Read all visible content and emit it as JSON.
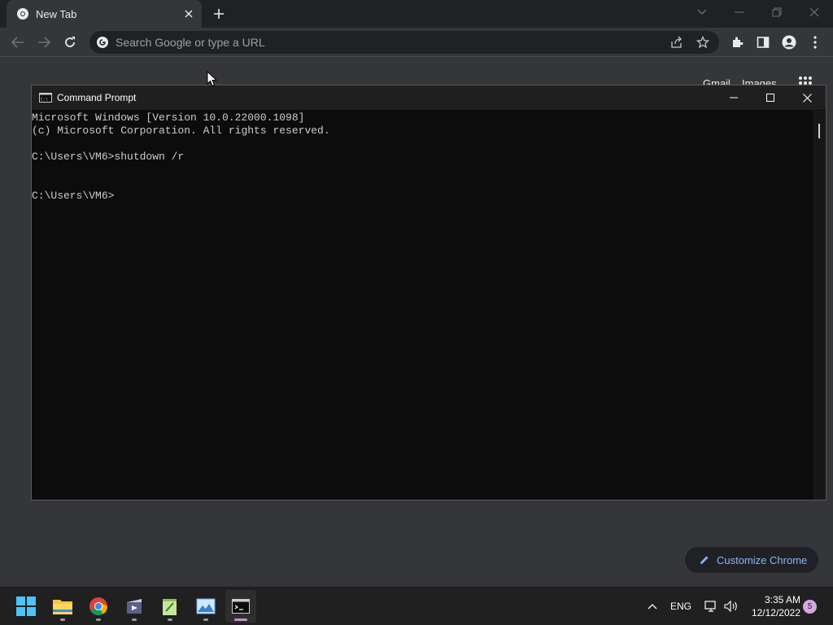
{
  "browser": {
    "tab_title": "New Tab",
    "omnibox_placeholder": "Search Google or type a URL",
    "ntp": {
      "gmail_label": "Gmail",
      "images_label": "Images",
      "customize_label": "Customize Chrome"
    }
  },
  "cmd": {
    "title": "Command Prompt",
    "lines": [
      "Microsoft Windows [Version 10.0.22000.1098]",
      "(c) Microsoft Corporation. All rights reserved.",
      "",
      "C:\\Users\\VM6>shutdown /r",
      "",
      "",
      "C:\\Users\\VM6>"
    ]
  },
  "taskbar": {
    "apps": [
      "start-icon",
      "file-explorer-icon",
      "chrome-icon",
      "video-editor-icon",
      "notepad-plus-icon",
      "photo-viewer-icon",
      "command-prompt-icon"
    ],
    "language": "ENG",
    "time": "3:35 AM",
    "date": "12/12/2022",
    "notification_count": "5"
  },
  "colors": {
    "chrome_dark": "#202124",
    "chrome_toolbar": "#35363a",
    "link_blue": "#8ab4f8",
    "console_bg": "#0c0c0c",
    "console_text": "#cccccc",
    "taskbar": "#202020",
    "active_accent": "#d389d6"
  }
}
